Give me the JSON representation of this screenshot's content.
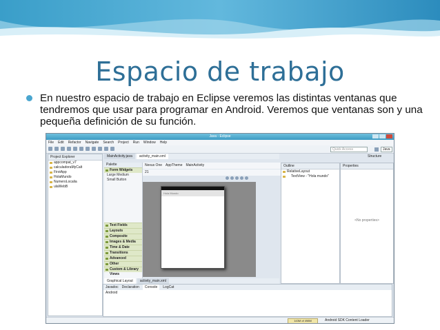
{
  "slide": {
    "title": "Espacio de trabajo",
    "bullet": "En nuestro espacio de trabajo en Eclipse veremos las distintas ventanas que tendremos que usar para programar en Android. Veremos que ventanas son y una pequeña definición de su función."
  },
  "colors": {
    "title": "#2e6f97",
    "bullet": "#4aa6cf",
    "header_top": "#3a9ec9",
    "header_light": "#bfe3f1"
  },
  "eclipse": {
    "window_title": "Java - Eclipse",
    "menu": [
      "File",
      "Edit",
      "Refactor",
      "Navigate",
      "Search",
      "Project",
      "Run",
      "Window",
      "Help"
    ],
    "quick_access": "Quick Access",
    "perspective": "Java",
    "project_explorer": {
      "title": "Project Explorer",
      "items": [
        "appcompat_v7",
        "calculadoraMyCalt",
        "FirstApp",
        "HolaMundo",
        "NumeroLocalia",
        "ulaWebB"
      ]
    },
    "editor_tabs": [
      "MainActivity.java",
      "activity_main.xml"
    ],
    "palette": {
      "title": "Palette",
      "rows": [
        "Form Widgets",
        "Large  Medium",
        "Small  Button"
      ],
      "sections": [
        "Text Fields",
        "Layouts",
        "Composite",
        "Images & Media",
        "Time & Date",
        "Transitions",
        "Advanced",
        "Other",
        "Custom & Library Views"
      ]
    },
    "editor_toolbar": [
      "Nexus One",
      "AppTheme",
      "MainActivity"
    ],
    "api_level": "21",
    "phone_app_title": "Hola Mundo",
    "layout_tabs": [
      "Graphical Layout",
      "activity_main.xml"
    ],
    "outline": {
      "title": "Outline",
      "items": [
        "RelativeLayout",
        "TextView - \"Hola mundo\""
      ]
    },
    "properties": {
      "title": "Properties",
      "empty": "<No properties>"
    },
    "structure_label": "Structure",
    "console": {
      "tabs": [
        "Javadoc",
        "Declaration",
        "Console",
        "LogCat"
      ],
      "content": "Android"
    },
    "status": {
      "heap": "143M of 498M",
      "loader": "Android SDK Content Loader"
    }
  }
}
